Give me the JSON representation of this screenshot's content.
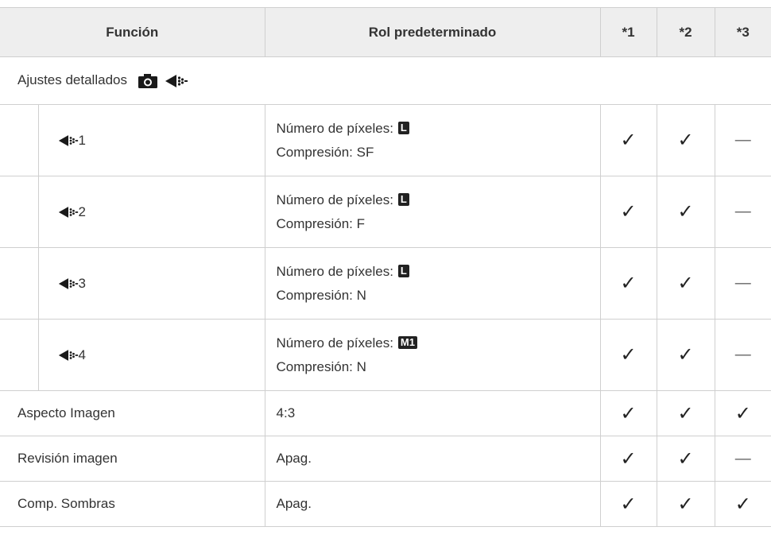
{
  "header": {
    "col_function": "Función",
    "col_role": "Rol predeterminado",
    "col_1": "*1",
    "col_2": "*2",
    "col_3": "*3"
  },
  "section": {
    "label": "Ajustes detallados",
    "icons": [
      "camera-icon",
      "image-quality-icon"
    ]
  },
  "sub_rows": [
    {
      "index": "1",
      "pixels_label": "Número de píxeles:",
      "pixels_badge": "L",
      "compression": "Compresión: SF",
      "c1": "✓",
      "c2": "✓",
      "c3": "—"
    },
    {
      "index": "2",
      "pixels_label": "Número de píxeles:",
      "pixels_badge": "L",
      "compression": "Compresión: F",
      "c1": "✓",
      "c2": "✓",
      "c3": "—"
    },
    {
      "index": "3",
      "pixels_label": "Número de píxeles:",
      "pixels_badge": "L",
      "compression": "Compresión: N",
      "c1": "✓",
      "c2": "✓",
      "c3": "—"
    },
    {
      "index": "4",
      "pixels_label": "Número de píxeles:",
      "pixels_badge": "M1",
      "compression": "Compresión: N",
      "c1": "✓",
      "c2": "✓",
      "c3": "—"
    }
  ],
  "rows": [
    {
      "function": "Aspecto Imagen",
      "role": "4:3",
      "c1": "✓",
      "c2": "✓",
      "c3": "✓"
    },
    {
      "function": "Revisión imagen",
      "role": "Apag.",
      "c1": "✓",
      "c2": "✓",
      "c3": "—"
    },
    {
      "function": "Comp. Sombras",
      "role": "Apag.",
      "c1": "✓",
      "c2": "✓",
      "c3": "✓"
    }
  ]
}
